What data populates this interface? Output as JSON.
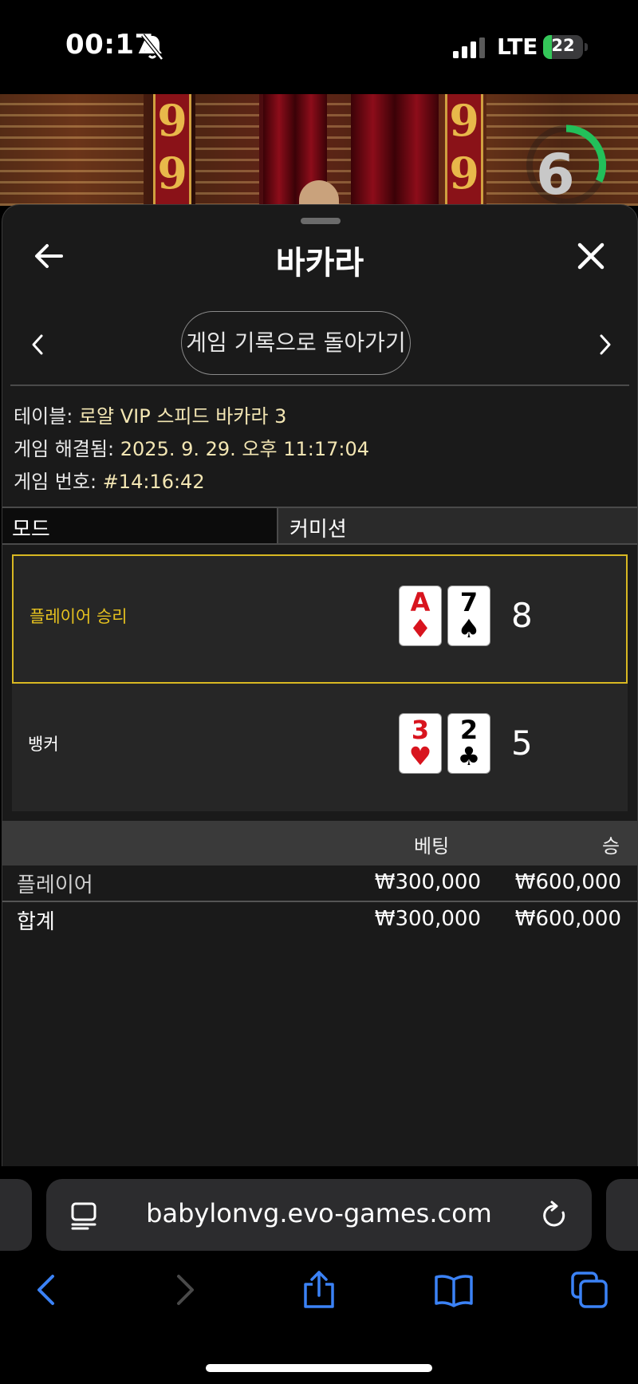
{
  "status_bar": {
    "time": "00:17",
    "network": "LTE",
    "battery": "22",
    "battery_level": 0.22,
    "icons": [
      "bell-slash-icon",
      "signal-icon",
      "battery-charging-icon"
    ]
  },
  "video": {
    "countdown": "6",
    "pillar_numbers": [
      "9",
      "9",
      "9",
      "9"
    ]
  },
  "sheet": {
    "title": "바카라",
    "history_button": "게임 기록으로 돌아가기",
    "info": {
      "table_label": "테이블:",
      "table_value": "로얄 VIP 스피드 바카라 3",
      "resolved_label": "게임 해결됨:",
      "resolved_value": "2025. 9. 29. 오후 11:17:04",
      "game_no_label": "게임 번호:",
      "game_no_value": "#14:16:42"
    },
    "mode_label": "모드",
    "commission_label": "커미션"
  },
  "results": [
    {
      "label": "플레이어 승리",
      "winner": true,
      "cards": [
        {
          "rank": "A",
          "suit": "♦",
          "color": "red"
        },
        {
          "rank": "7",
          "suit": "♠",
          "color": "black"
        }
      ],
      "score": "8"
    },
    {
      "label": "뱅커",
      "winner": false,
      "cards": [
        {
          "rank": "3",
          "suit": "♥",
          "color": "red"
        },
        {
          "rank": "2",
          "suit": "♣",
          "color": "black"
        }
      ],
      "score": "5"
    }
  ],
  "bets": {
    "header_bet": "베팅",
    "header_win": "승",
    "rows": [
      {
        "name": "플레이어",
        "bet": "₩300,000",
        "win": "₩600,000"
      },
      {
        "name": "합계",
        "bet": "₩300,000",
        "win": "₩600,000"
      }
    ]
  },
  "browser": {
    "url": "babylonvg.evo-games.com",
    "icons": [
      "reader-icon",
      "reload-icon",
      "back-icon",
      "forward-icon",
      "share-icon",
      "bookmarks-icon",
      "tabs-icon"
    ]
  },
  "colors": {
    "accent_win": "#e6c21f",
    "link_blue": "#3b82f6",
    "card_red": "#d8141e"
  }
}
